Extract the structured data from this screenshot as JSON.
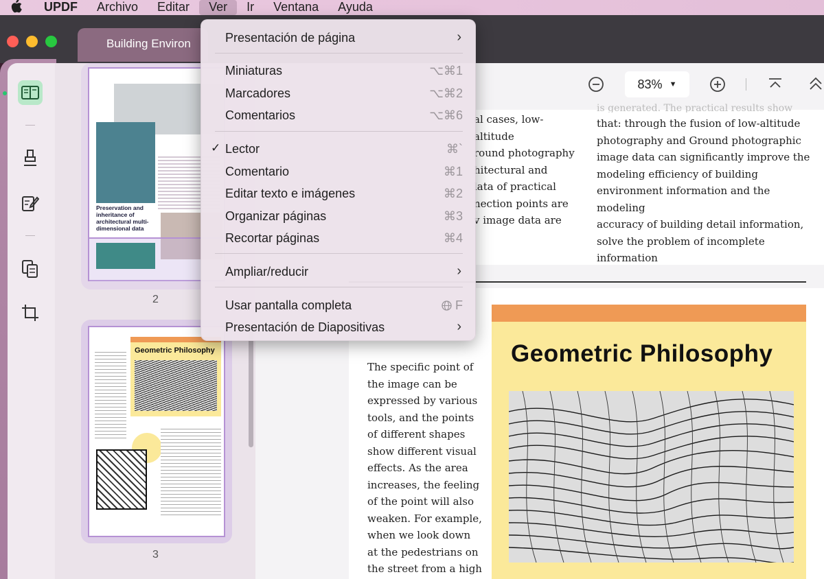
{
  "menubar": {
    "app": "UPDF",
    "items": [
      "Archivo",
      "Editar",
      "Ver",
      "Ir",
      "Ventana",
      "Ayuda"
    ]
  },
  "window": {
    "tab_title": "Building Environ"
  },
  "thumbnails": {
    "page2_num": "2",
    "page3_num": "3",
    "page2_caption": "Preservation and inheritance of architectural multi-dimensional data",
    "page3_title": "Geometric Philosophy"
  },
  "toolbar": {
    "zoom_value": "83%"
  },
  "menu": {
    "presentacion_pagina": "Presentación de página",
    "miniaturas": "Miniaturas",
    "miniaturas_sc": "⌥⌘1",
    "marcadores": "Marcadores",
    "marcadores_sc": "⌥⌘2",
    "comentarios": "Comentarios",
    "comentarios_sc": "⌥⌘6",
    "lector": "Lector",
    "lector_sc": "⌘`",
    "comentario": "Comentario",
    "comentario_sc": "⌘1",
    "editar_texto": "Editar texto e imágenes",
    "editar_texto_sc": "⌘2",
    "organizar": "Organizar páginas",
    "organizar_sc": "⌘3",
    "recortar": "Recortar páginas",
    "recortar_sc": "⌘4",
    "ampliar": "Ampliar/reducir",
    "pantalla_completa": "Usar pantalla completa",
    "pantalla_completa_sc": "F",
    "diapositivas": "Presentación de Diapositivas"
  },
  "document": {
    "col1_lines": [
      "al cases, low-altitude",
      "round photography",
      "hitectural and",
      "lata of practical",
      "nection points are",
      "v image data are"
    ],
    "col2_top": "is generated. The practical results show",
    "col2_lines": [
      "that: through the fusion of low-altitude",
      "photography and Ground photographic",
      "image data can significantly improve the",
      "modeling efficiency of building",
      "environment information and the modeling",
      "accuracy of building detail information,",
      "solve the problem of incomplete",
      "information"
    ],
    "page2_lines": [
      "The specific point of",
      "the image can be",
      "expressed by various",
      "tools, and the points",
      "of different shapes",
      "show different visual",
      "effects. As the area",
      "increases, the feeling",
      "of the point will also",
      "weaken. For example,",
      "when we look down",
      "at the pedestrians on",
      "the street from a high"
    ],
    "poster_title": "Geometric Philosophy"
  }
}
